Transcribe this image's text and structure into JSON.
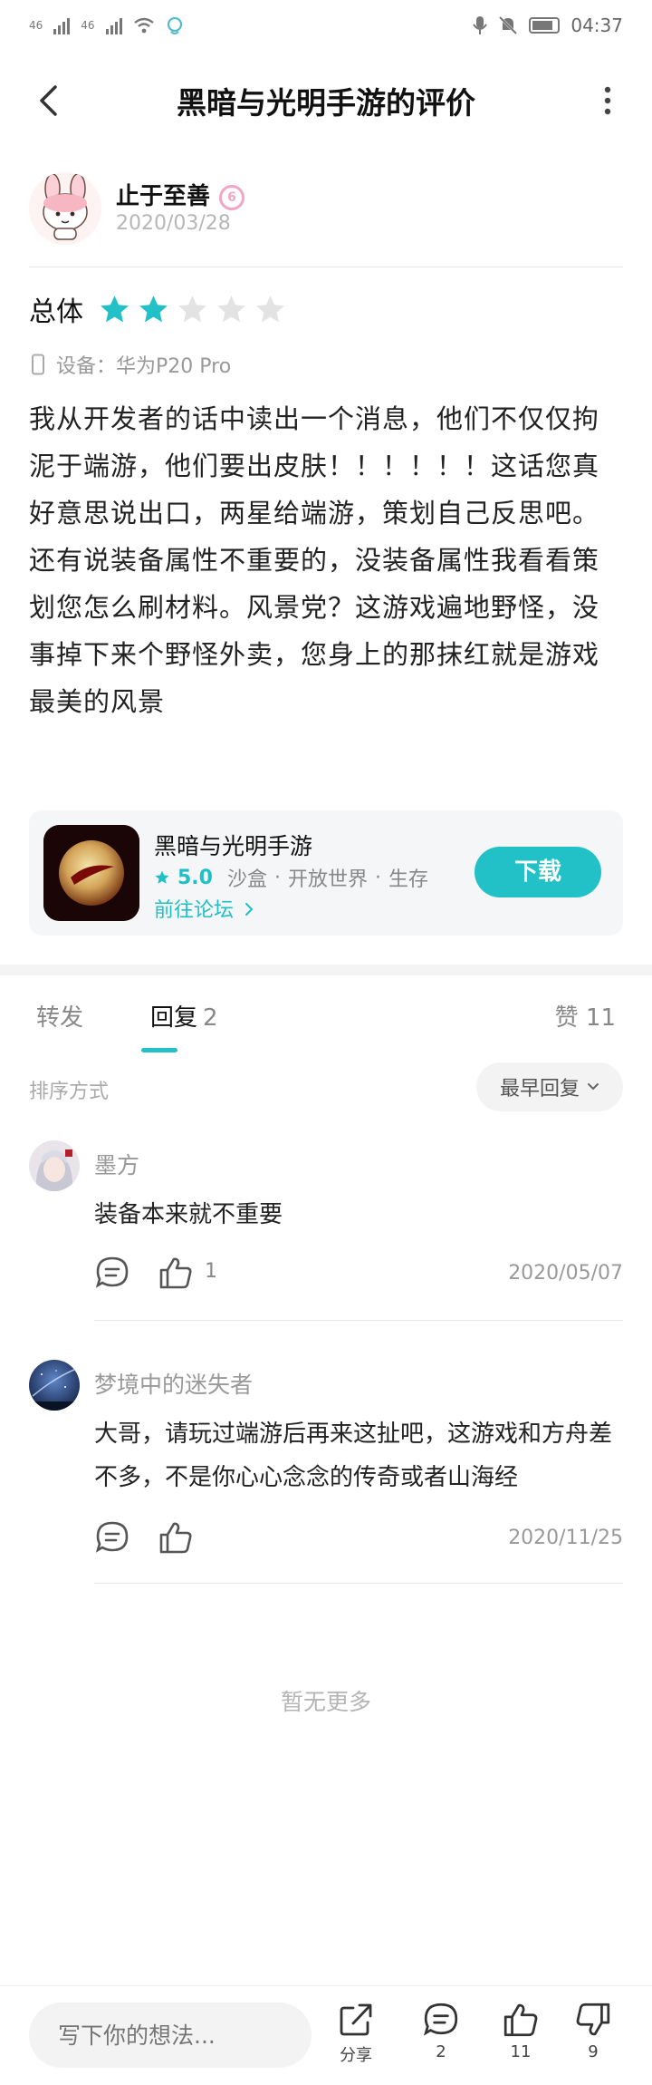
{
  "status_bar": {
    "network_left": "46",
    "network_right": "46",
    "time": "04:37"
  },
  "nav": {
    "title": "黑暗与光明手游的评价"
  },
  "author": {
    "name": "止于至善",
    "level_badge": "6",
    "date": "2020/03/28"
  },
  "rating": {
    "label": "总体",
    "stars": 2,
    "max_stars": 5
  },
  "device": {
    "label": "设备：华为P20 Pro"
  },
  "review": {
    "text": "我从开发者的话中读出一个消息，他们不仅仅拘泥于端游，他们要出皮肤！！！！！！这话您真好意思说出口，两星给端游，策划自己反思吧。还有说装备属性不重要的，没装备属性我看看策划您怎么刷材料。风景党？这游戏遍地野怪，没事掉下来个野怪外卖，您身上的那抹红就是游戏最美的风景"
  },
  "game_card": {
    "title": "黑暗与光明手游",
    "score": "5.0",
    "tags": [
      "沙盒",
      "开放世界",
      "生存"
    ],
    "forum_link": "前往论坛",
    "download_label": "下载"
  },
  "tabs": {
    "forward": "转发",
    "reply": "回复",
    "reply_count": "2",
    "likes": "赞 11"
  },
  "sort": {
    "label": "排序方式",
    "selected": "最早回复"
  },
  "replies": [
    {
      "name": "墨方",
      "text": "装备本来就不重要",
      "like_count": "1",
      "date": "2020/05/07"
    },
    {
      "name": "梦境中的迷失者",
      "text": "大哥，请玩过端游后再来这扯吧，这游戏和方舟差不多，不是你心心念念的传奇或者山海经",
      "like_count": "",
      "date": "2020/11/25"
    }
  ],
  "no_more": "暂无更多",
  "bottom_bar": {
    "input_placeholder": "写下你的想法...",
    "share_label": "分享",
    "comment_count": "2",
    "like_count": "11",
    "dislike_count": "9"
  },
  "colors": {
    "accent": "#22c1c7",
    "star_on": "#22c1c7",
    "star_off": "#e3e3e3",
    "level_badge": "#f3a5c6"
  }
}
